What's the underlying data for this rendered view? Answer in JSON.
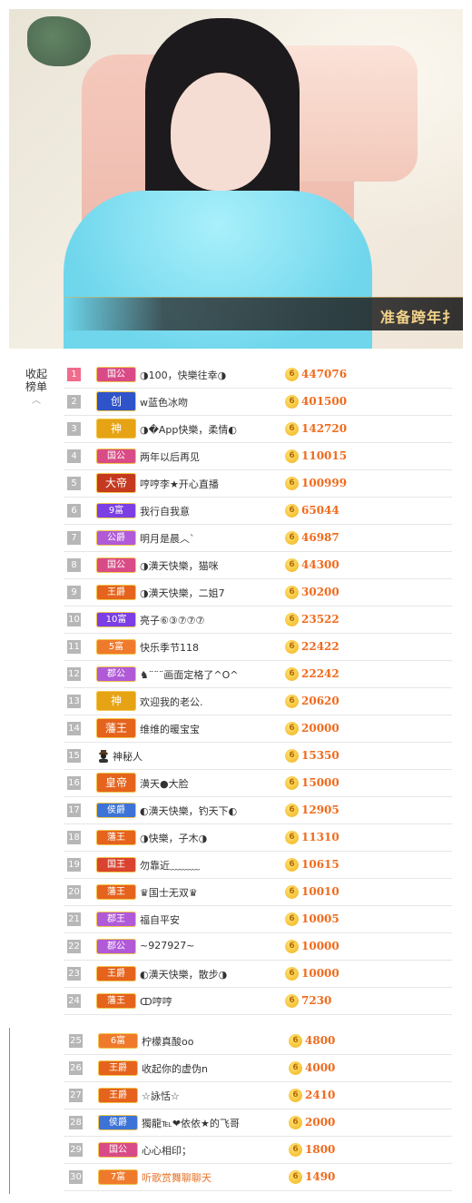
{
  "stream": {
    "banner_text": "准备跨年扌"
  },
  "panel": {
    "collapse_label_1": "收起",
    "collapse_label_2": "榜单",
    "chevron_icon": "chevron-up-icon"
  },
  "coin_glyph": "6",
  "ranking_top": [
    {
      "rank": "1",
      "badge": "国公",
      "badge_color": "#d94b86",
      "name": "◑100，快樂往幸◑",
      "value": "447076"
    },
    {
      "rank": "2",
      "badge": "创",
      "badge_color": "#2f53c9",
      "name": "w蓝色冰吻",
      "value": "401500",
      "big": true
    },
    {
      "rank": "3",
      "badge": "神",
      "badge_color": "#e6a314",
      "name": "◑�App快樂，柔情◐",
      "value": "142720",
      "big": true
    },
    {
      "rank": "4",
      "badge": "国公",
      "badge_color": "#d94b86",
      "name": "两年以后再见",
      "value": "110015"
    },
    {
      "rank": "5",
      "badge": "大帝",
      "badge_color": "#c53a1f",
      "name": "哼哼李★开心直播",
      "value": "100999",
      "big": true
    },
    {
      "rank": "6",
      "badge": "9富",
      "badge_color": "#7b3fe4",
      "name": "我行自我意",
      "value": "65044"
    },
    {
      "rank": "7",
      "badge": "公爵",
      "badge_color": "#b05ad8",
      "name": "明月是晨︿`",
      "value": "46987"
    },
    {
      "rank": "8",
      "badge": "国公",
      "badge_color": "#d94b86",
      "name": "◑潢天快樂，猫咪",
      "value": "44300"
    },
    {
      "rank": "9",
      "badge": "王爵",
      "badge_color": "#e5631c",
      "name": "◑潢天快樂，二姐7",
      "value": "30200"
    },
    {
      "rank": "10",
      "badge": "10富",
      "badge_color": "#7b3fe4",
      "name": "亮子⑥③⑦⑦⑦",
      "value": "23522"
    },
    {
      "rank": "11",
      "badge": "5富",
      "badge_color": "#ef7a2c",
      "name": "快乐季节118",
      "value": "22422"
    },
    {
      "rank": "12",
      "badge": "郡公",
      "badge_color": "#b05ad8",
      "name": "♞¨¨¨画面定格了^O^",
      "value": "22242"
    },
    {
      "rank": "13",
      "badge": "神",
      "badge_color": "#e6a314",
      "name": "欢迎我的老公.",
      "value": "20620",
      "big": true
    },
    {
      "rank": "14",
      "badge": "藩王",
      "badge_color": "#e5631c",
      "name": "维维的暖宝宝",
      "value": "20000",
      "big": true
    },
    {
      "rank": "15",
      "badge": "",
      "badge_color": "",
      "name": "神秘人",
      "value": "15350",
      "mystery": true
    },
    {
      "rank": "16",
      "badge": "皇帝",
      "badge_color": "#e5631c",
      "name": "潢天●大脸",
      "value": "15000",
      "big": true
    },
    {
      "rank": "17",
      "badge": "侯爵",
      "badge_color": "#3d73d6",
      "name": "◐潢天快樂，钓天下◐",
      "value": "12905"
    },
    {
      "rank": "18",
      "badge": "藩王",
      "badge_color": "#e5631c",
      "name": "◑快樂，子木◑",
      "value": "11310"
    },
    {
      "rank": "19",
      "badge": "国王",
      "badge_color": "#d9432f",
      "name": "勿靠近﹏﹏﹏",
      "value": "10615"
    },
    {
      "rank": "20",
      "badge": "藩王",
      "badge_color": "#e5631c",
      "name": "♛国士无双♛",
      "value": "10010"
    },
    {
      "rank": "21",
      "badge": "郡王",
      "badge_color": "#b05ad8",
      "name": "福自平安",
      "value": "10005"
    },
    {
      "rank": "22",
      "badge": "郡公",
      "badge_color": "#b05ad8",
      "name": "~927927~",
      "value": "10000"
    },
    {
      "rank": "23",
      "badge": "王爵",
      "badge_color": "#e5631c",
      "name": "◐潢天快樂，散步◑",
      "value": "10000"
    },
    {
      "rank": "24",
      "badge": "藩王",
      "badge_color": "#e5631c",
      "name": "ↀ哼哼",
      "value": "7230"
    }
  ],
  "ranking_more": [
    {
      "rank": "25",
      "badge": "6富",
      "badge_color": "#ef7a2c",
      "name": "柠檬真酸oo",
      "value": "4800"
    },
    {
      "rank": "26",
      "badge": "王爵",
      "badge_color": "#e5631c",
      "name": "收起你的虚伪n",
      "value": "4000"
    },
    {
      "rank": "27",
      "badge": "王爵",
      "badge_color": "#e5631c",
      "name": "☆詠恬☆",
      "value": "2410"
    },
    {
      "rank": "28",
      "badge": "侯爵",
      "badge_color": "#3d73d6",
      "name": "獨龍℡❤依依★的飞哥",
      "value": "2000"
    },
    {
      "rank": "29",
      "badge": "国公",
      "badge_color": "#d94b86",
      "name": "心心相印；",
      "value": "1800"
    },
    {
      "rank": "30",
      "badge": "7富",
      "badge_color": "#ef7a2c",
      "name": "听歌赏舞聊聊天",
      "value": "1490",
      "name_color": "#e8742a"
    }
  ]
}
